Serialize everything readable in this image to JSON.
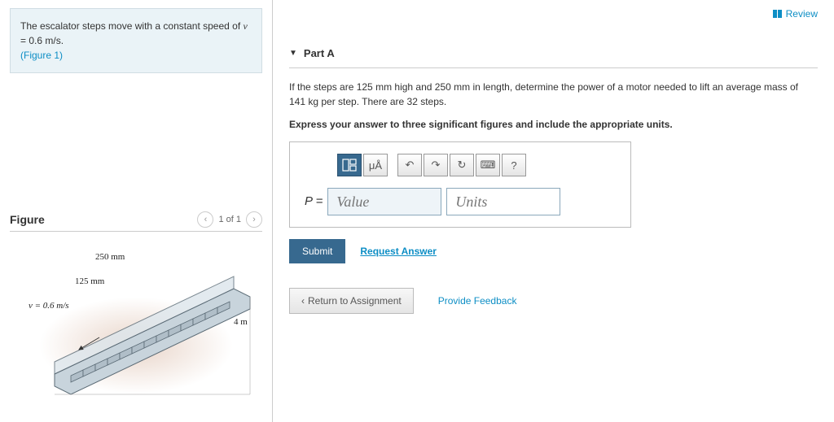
{
  "review": {
    "label": "Review"
  },
  "problem": {
    "text_1": "The escalator steps move with a constant speed of ",
    "var_v": "v",
    "eq": " = ",
    "speed_val": "0.6 m/s",
    "period": ".",
    "figure_link": "(Figure 1)"
  },
  "figure": {
    "header": "Figure",
    "pager": "1 of 1",
    "dim_250": "250 mm",
    "dim_125": "125 mm",
    "dim_v": "v = 0.6 m/s",
    "dim_4m": "4 m"
  },
  "part": {
    "title": "Part A",
    "question": "If the steps are 125 mm high and 250 mm in length, determine the power of a motor needed to lift an average mass of 141 kg per step. There are 32 steps.",
    "instruction": "Express your answer to three significant figures and include the appropriate units."
  },
  "toolbar": {
    "template": "▯▯",
    "units_sym": "μÅ",
    "undo": "↶",
    "redo": "↷",
    "reset": "↻",
    "keyboard": "⌨",
    "help": "?"
  },
  "answer": {
    "label": "P",
    "eq": " = ",
    "value_ph": "Value",
    "units_ph": "Units"
  },
  "actions": {
    "submit": "Submit",
    "request": "Request Answer",
    "return": "Return to Assignment",
    "feedback": "Provide Feedback"
  }
}
